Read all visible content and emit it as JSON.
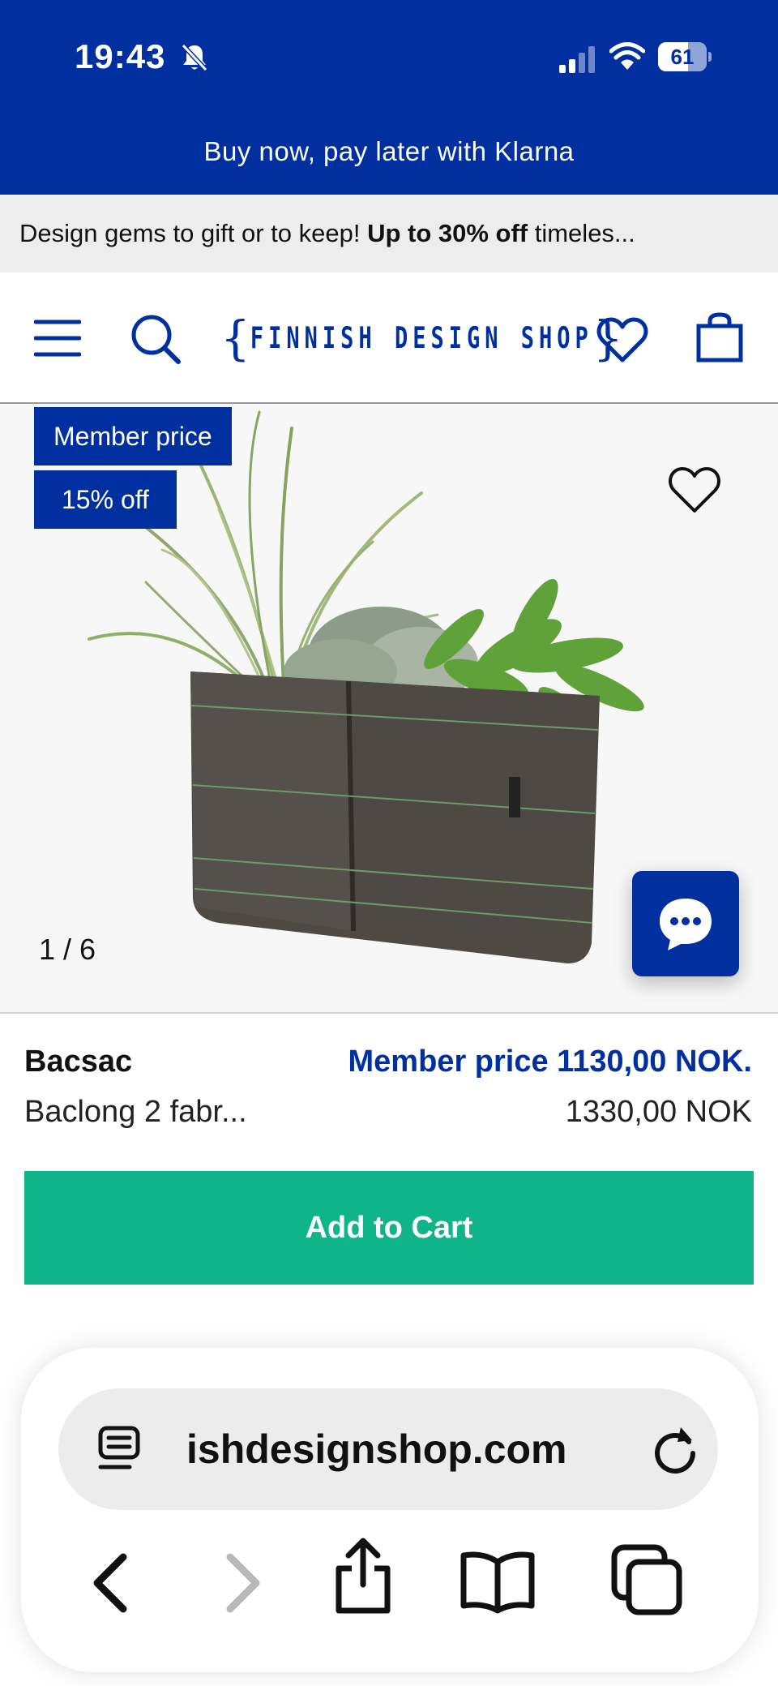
{
  "status_bar": {
    "time": "19:43",
    "battery": "61",
    "battery_level": 0.61
  },
  "banner": {
    "text": "Buy now, pay later with Klarna"
  },
  "promo": {
    "text_1": "Design gems to gift or to keep! ",
    "text_bold": "Up to 30% off",
    "text_2": " timeles..."
  },
  "header": {
    "logo_text": "FINNISH DESIGN SHOP",
    "icons": [
      "menu-icon",
      "search-icon",
      "heart-icon",
      "shopping-bag-icon"
    ]
  },
  "product": {
    "badge_member": "Member price",
    "badge_off": "15% off",
    "image_counter": "1 / 6",
    "brand": "Bacsac",
    "name": "Baclong 2 fabr...",
    "member_price": "Member price 1130,00 NOK.",
    "price": "1330,00 NOK",
    "add_to_cart": "Add to Cart"
  },
  "browser": {
    "url": "ishdesignshop.com",
    "toolbar_icons": [
      "back-icon",
      "forward-icon",
      "share-icon",
      "bookmarks-icon",
      "tabs-icon"
    ]
  },
  "colors": {
    "brand_blue": "#002f9f",
    "cart_green": "#0fb489",
    "promo_bg": "#ededed"
  }
}
